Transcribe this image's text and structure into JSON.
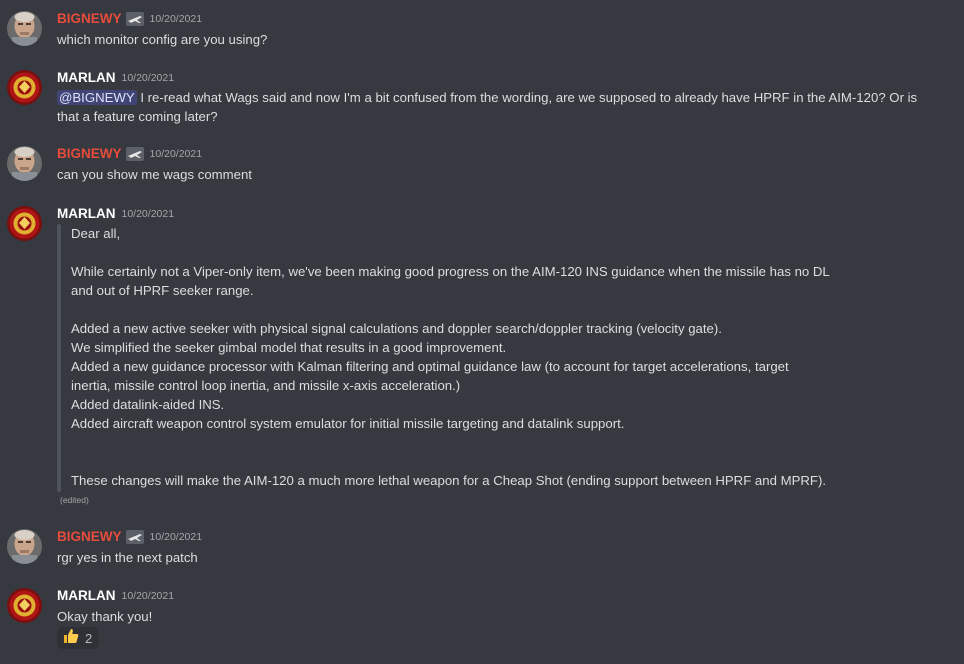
{
  "colors": {
    "background": "#36393f",
    "bignewy_name": "#e74c3c",
    "marlan_name": "#ffffff",
    "text": "#dcddde",
    "timestamp": "#a3a6aa"
  },
  "messages": [
    {
      "author": "BIGNEWY",
      "has_badge": true,
      "avatar": "bignewy-avatar",
      "timestamp": "10/20/2021",
      "text": "which monitor config are you using?"
    },
    {
      "author": "MARLAN",
      "avatar": "marlan-avatar",
      "timestamp": "10/20/2021",
      "mention": "@BIGNEWY",
      "text_line1": " I re-read what Wags said and now I'm a bit confused from the wording, are we supposed to already have HPRF in the AIM-120? Or is",
      "text_line2": "that a feature coming later?"
    },
    {
      "author": "BIGNEWY",
      "has_badge": true,
      "avatar": "bignewy-avatar",
      "timestamp": "10/20/2021",
      "text": "can you show me wags comment"
    },
    {
      "author": "MARLAN",
      "avatar": "marlan-avatar",
      "timestamp": "10/20/2021",
      "quote_lines": [
        "Dear all,",
        "",
        "While certainly not a Viper-only item, we've been making good progress on the AIM-120 INS guidance when the missile has no DL",
        "and out of HPRF seeker range.",
        "",
        "Added a new active seeker with physical signal calculations and doppler search/doppler tracking (velocity gate).",
        "We simplified the seeker gimbal model that results in a good improvement.",
        "Added a new guidance processor with Kalman filtering and optimal guidance law (to account for target accelerations, target",
        "inertia, missile control loop inertia, and missile x-axis acceleration.)",
        "Added datalink-aided INS.",
        "Added aircraft weapon control system emulator for initial missile targeting and datalink support.",
        "",
        "",
        "These changes will make the AIM-120 a much more lethal weapon for a Cheap Shot (ending support between HPRF and MPRF)."
      ],
      "edited_label": "(edited)"
    },
    {
      "author": "BIGNEWY",
      "has_badge": true,
      "avatar": "bignewy-avatar",
      "timestamp": "10/20/2021",
      "text": "rgr yes in the next patch"
    },
    {
      "author": "MARLAN",
      "avatar": "marlan-avatar",
      "timestamp": "10/20/2021",
      "text": "Okay thank you!",
      "reaction": {
        "icon": "thumbs-up-icon",
        "count": "2"
      }
    }
  ]
}
